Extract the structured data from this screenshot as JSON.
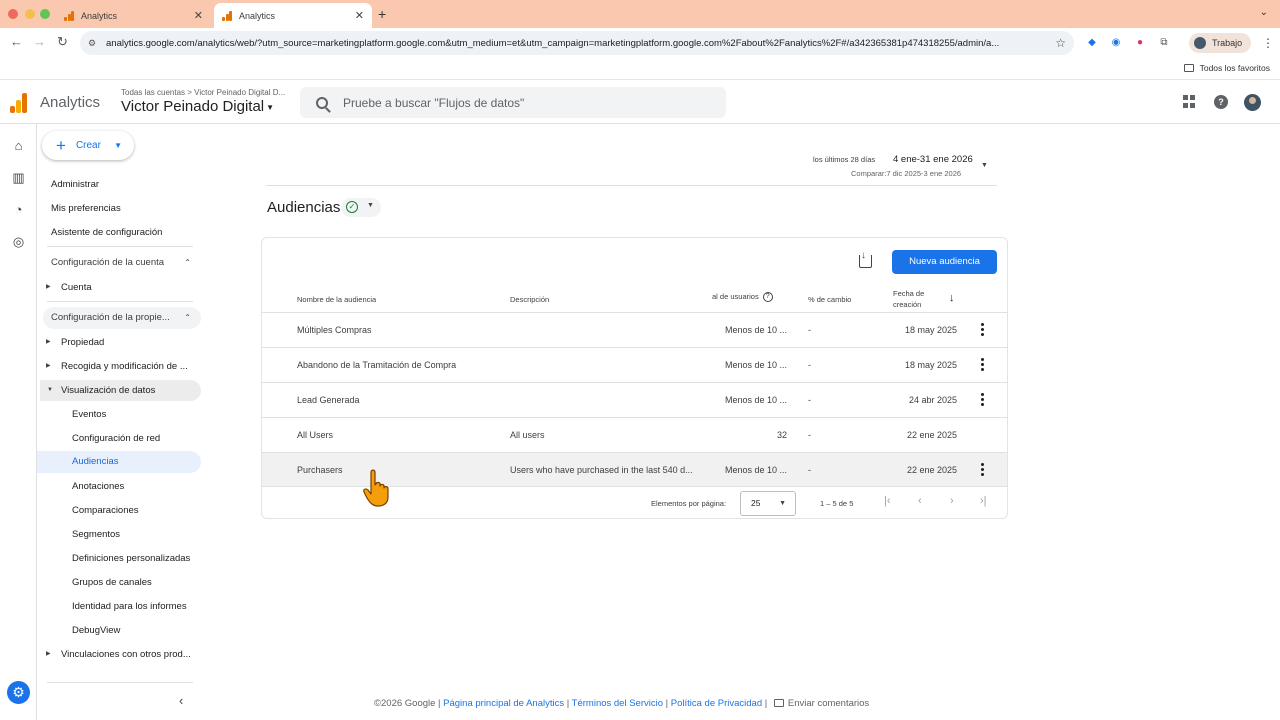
{
  "browser": {
    "tabs": [
      {
        "title": "Analytics",
        "active": false
      },
      {
        "title": "Analytics",
        "active": true
      }
    ],
    "url": "analytics.google.com/analytics/web/?utm_source=marketingplatform.google.com&utm_medium=et&utm_campaign=marketingplatform.google.com%2Fabout%2Fanalytics%2F#/a342365381p474318255/admin/a...",
    "profile_label": "Trabajo",
    "bookmarks_folder": "Todos los favoritos"
  },
  "header": {
    "app_name": "Analytics",
    "breadcrumb": "Todas las cuentas > Victor Peinado Digital D...",
    "account_name": "Victor Peinado Digital",
    "search_placeholder": "Pruebe a buscar \"Flujos de datos\""
  },
  "sidebar": {
    "create_label": "Crear",
    "top_items": [
      "Administrar",
      "Mis preferencias",
      "Asistente de configuración"
    ],
    "section_account": "Configuración de la cuenta",
    "account_items": [
      "Cuenta"
    ],
    "section_property": "Configuración de la propie...",
    "property_items": [
      "Propiedad",
      "Recogida y modificación de ...",
      "Visualización de datos"
    ],
    "data_display_items": [
      "Eventos",
      "Configuración de red",
      "Audiencias",
      "Anotaciones",
      "Comparaciones",
      "Segmentos",
      "Definiciones personalizadas",
      "Grupos de canales",
      "Identidad para los informes",
      "DebugView"
    ],
    "linking_item": "Vinculaciones con otros prod..."
  },
  "date_range": {
    "label": "los últimos 28 días",
    "range": "4 ene-31 ene 2026",
    "compare": "Comparar:7 dic 2025-3 ene 2026"
  },
  "page": {
    "title": "Audiencias",
    "new_audience_button": "Nueva audiencia"
  },
  "table": {
    "headers": {
      "name": "Nombre de la audiencia",
      "description": "Descripción",
      "users": "al de usuarios",
      "change": "% de cambio",
      "created_line1": "Fecha de",
      "created_line2": "creación"
    },
    "rows": [
      {
        "name": "Múltiples Compras",
        "description": "",
        "users": "Menos de 10 ...",
        "change": "-",
        "created": "18 may 2025",
        "menu": true
      },
      {
        "name": "Abandono de la Tramitación de Compra",
        "description": "",
        "users": "Menos de 10 ...",
        "change": "-",
        "created": "18 may 2025",
        "menu": true
      },
      {
        "name": "Lead Generada",
        "description": "",
        "users": "Menos de 10 ...",
        "change": "-",
        "created": "24 abr 2025",
        "menu": true
      },
      {
        "name": "All Users",
        "description": "All users",
        "users": "32",
        "change": "-",
        "created": "22 ene 2025",
        "menu": false
      },
      {
        "name": "Purchasers",
        "description": "Users who have purchased in the last 540 d...",
        "users": "Menos de 10 ...",
        "change": "-",
        "created": "22 ene 2025",
        "menu": true
      }
    ],
    "pagination": {
      "per_page_label": "Elementos por página:",
      "per_page_value": "25",
      "range": "1 – 5 de 5"
    }
  },
  "footer": {
    "copyright": "©2026 Google |",
    "link1": "Página principal de Analytics",
    "link2": "Términos del Servicio",
    "link3": "Política de Privacidad",
    "feedback": "Enviar comentarios"
  },
  "colors": {
    "accent": "#1a73e8",
    "tabbar": "#f9c8ae",
    "selected_nav_bg": "#e8f0fe"
  }
}
